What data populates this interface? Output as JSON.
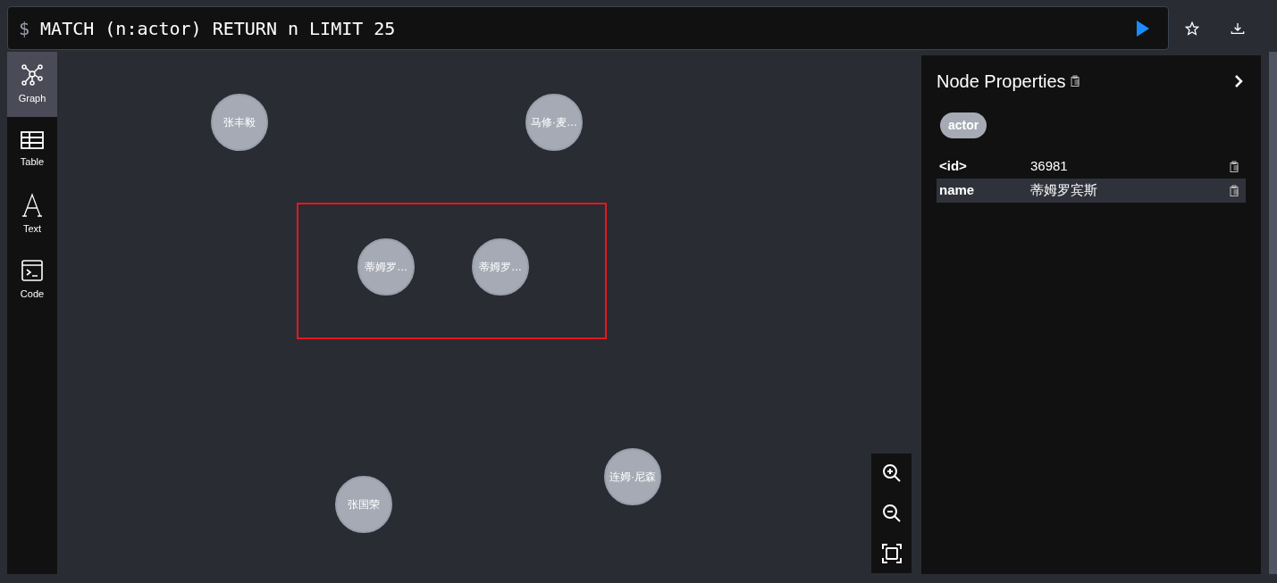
{
  "query": {
    "prompt": "$",
    "text": "MATCH (n:actor) RETURN n LIMIT 25"
  },
  "sidebar": {
    "items": [
      {
        "label": "Graph",
        "kind": "graph",
        "selected": true
      },
      {
        "label": "Table",
        "kind": "table",
        "selected": false
      },
      {
        "label": "Text",
        "kind": "text",
        "selected": false
      },
      {
        "label": "Code",
        "kind": "code",
        "selected": false
      }
    ]
  },
  "graph": {
    "nodes": [
      {
        "label": "张丰毅"
      },
      {
        "label": "马修·麦…"
      },
      {
        "label": "蒂姆罗…"
      },
      {
        "label": "蒂姆罗…"
      },
      {
        "label": "张国荣"
      },
      {
        "label": "连姆·尼森"
      }
    ]
  },
  "panel": {
    "title": "Node Properties",
    "labels": [
      "actor"
    ],
    "properties": [
      {
        "key": "<id>",
        "value": "36981",
        "selected": false
      },
      {
        "key": "name",
        "value": "蒂姆罗宾斯",
        "selected": true
      }
    ]
  }
}
